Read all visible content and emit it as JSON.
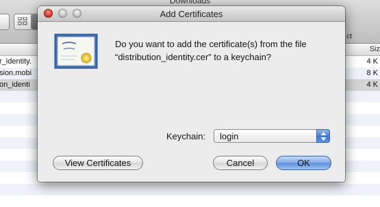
{
  "background": {
    "window_title": "Downloads",
    "toolbar_label": "ct",
    "size_column_header": "Siz",
    "rows": [
      {
        "name": "r_identity.",
        "size": "4 K"
      },
      {
        "name": "sion.mobi",
        "size": "8 K"
      },
      {
        "name": "on_identi",
        "size": "4 K"
      }
    ]
  },
  "dialog": {
    "title": "Add Certificates",
    "icon_label": "certificate-icon",
    "message_line1": "Do you want to add the certificate(s) from the file",
    "message_line2": "“distribution_identity.cer” to a keychain?",
    "keychain_label": "Keychain:",
    "keychain_value": "login",
    "buttons": {
      "view": "View Certificates",
      "cancel": "Cancel",
      "ok": "OK"
    }
  }
}
